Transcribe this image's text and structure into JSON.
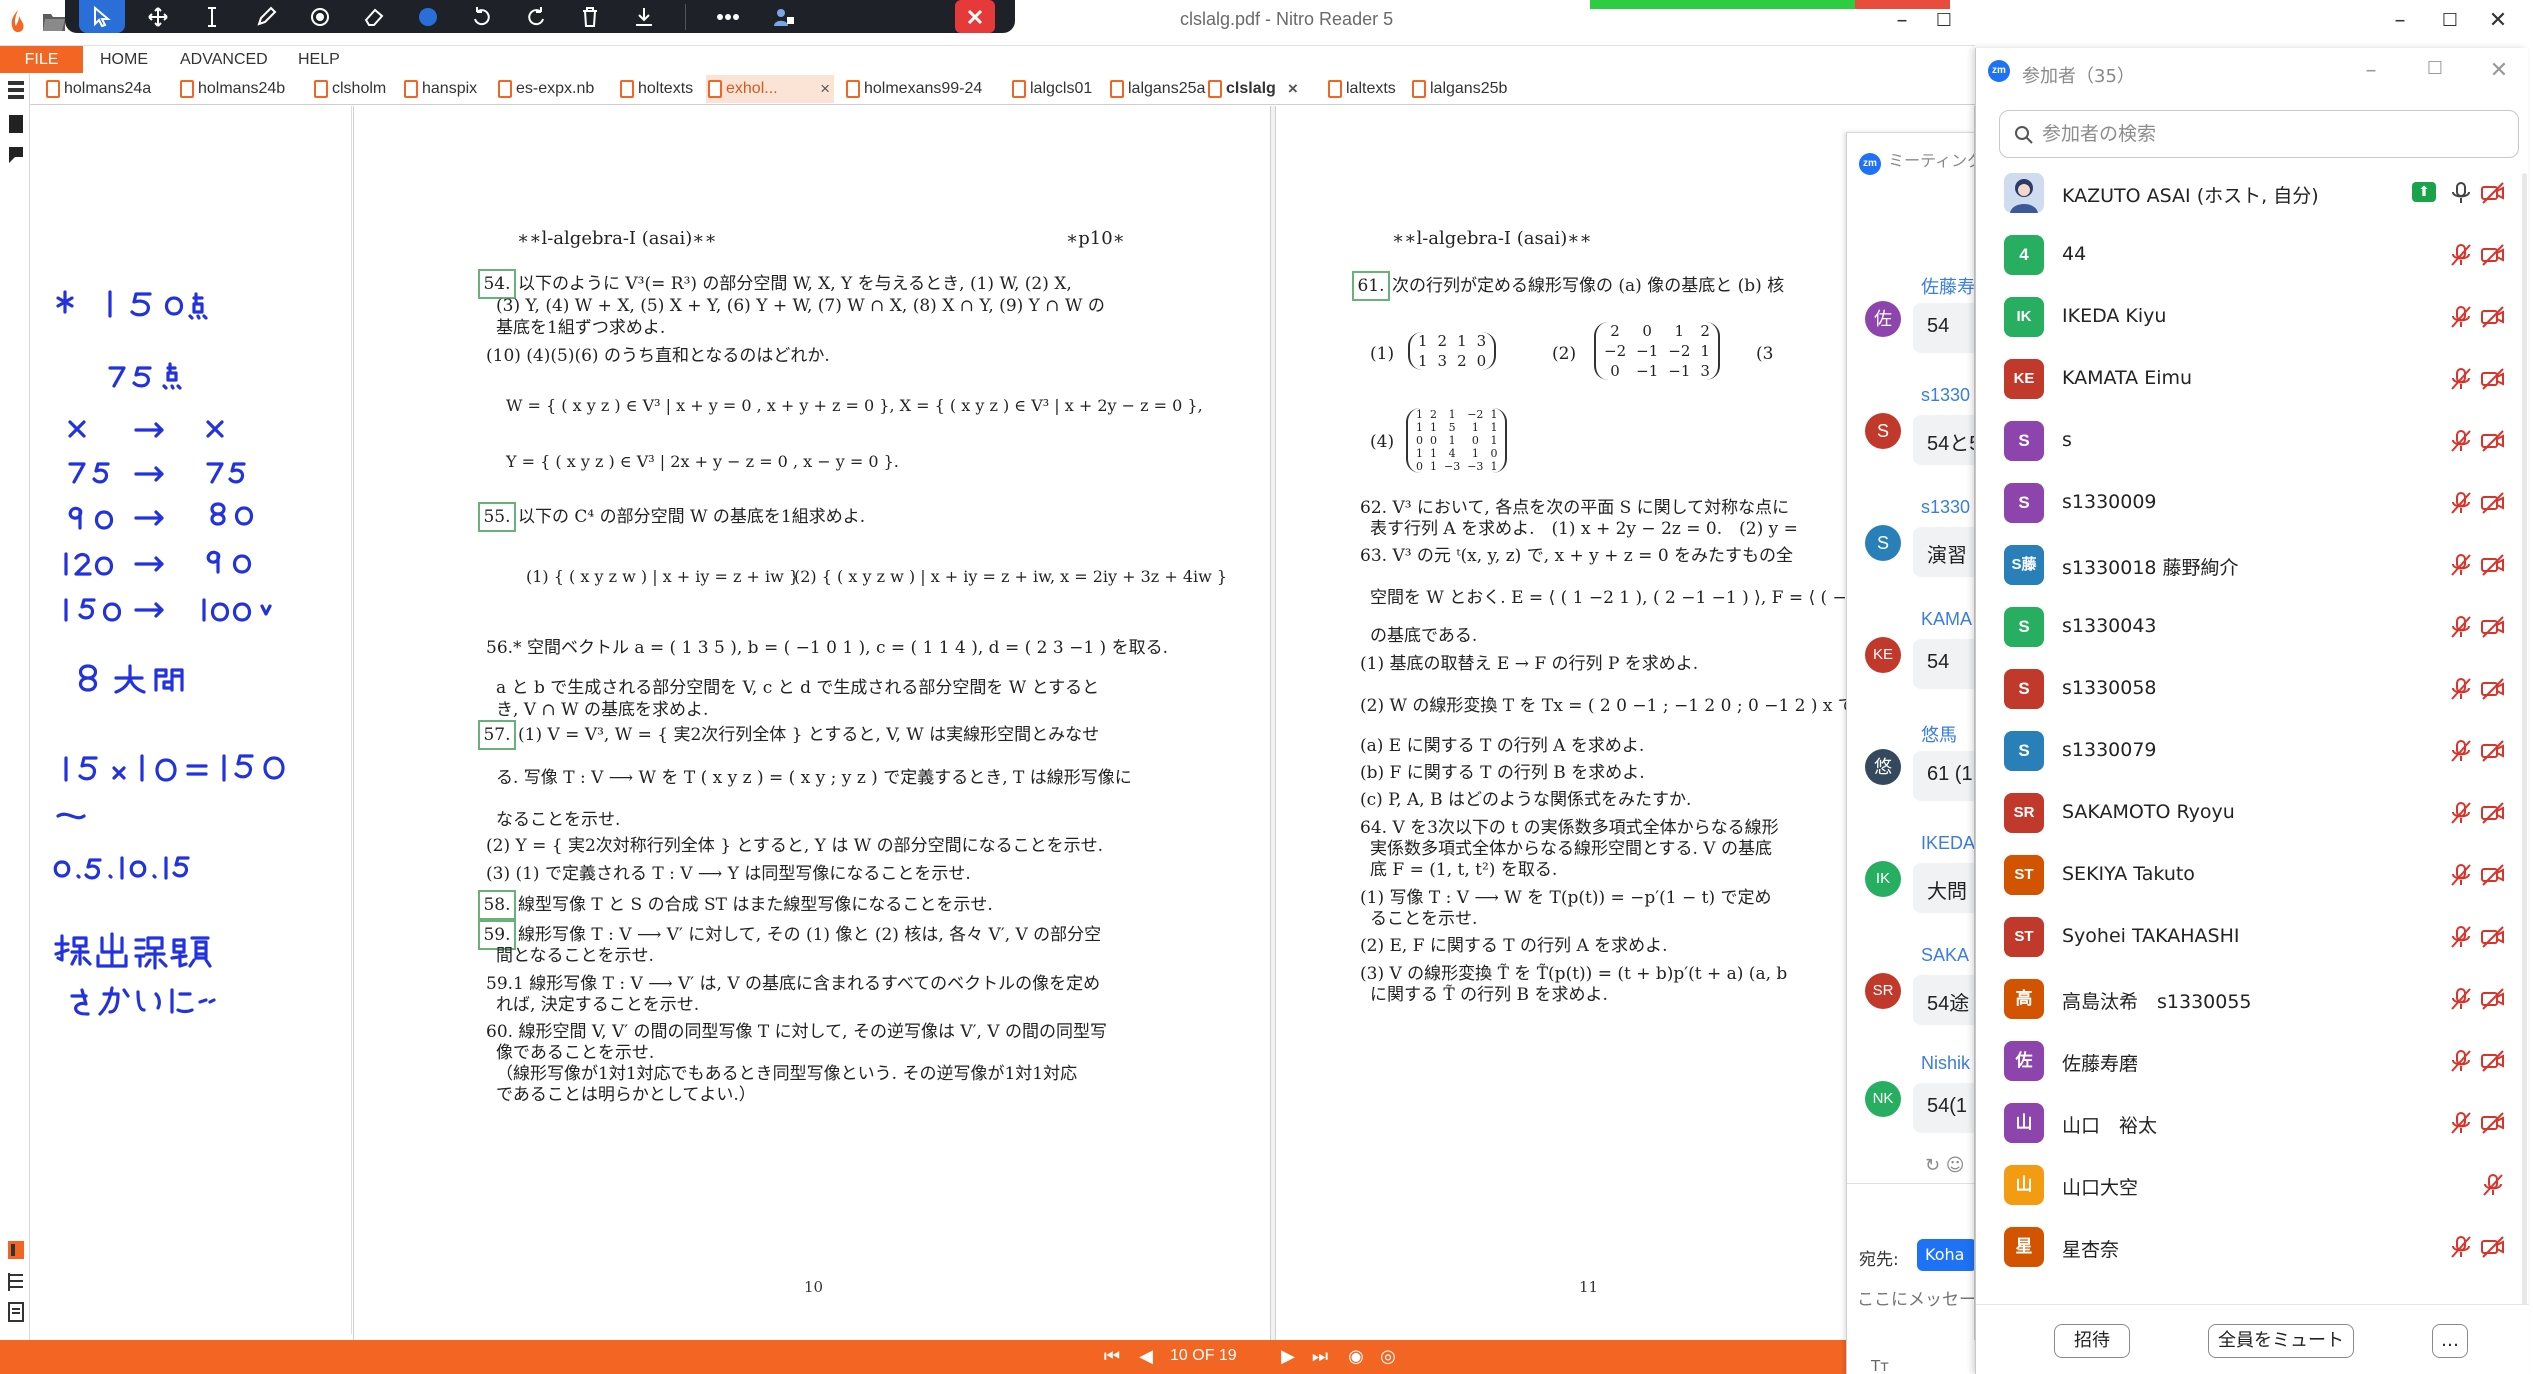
{
  "window": {
    "title": "clslalg.pdf - Nitro Reader 5",
    "controls": [
      "minimize-icon",
      "maximize-icon",
      "close-icon"
    ]
  },
  "annotation_toolbar": {
    "tools": [
      "select-arrow-icon",
      "move-icon",
      "text-cursor-icon",
      "pen-icon",
      "highlighter-icon",
      "eraser-icon",
      "color-dot-icon",
      "undo-icon",
      "redo-icon",
      "trash-icon",
      "download-icon",
      "more-icon",
      "share-screen-icon",
      "close-icon"
    ],
    "accent": "#2a6fd8"
  },
  "menu": {
    "file": "FILE",
    "items": [
      "HOME",
      "ADVANCED",
      "HELP"
    ],
    "accent": "#f26522"
  },
  "tabs": [
    {
      "label": "holmans24a"
    },
    {
      "label": "holmans24b"
    },
    {
      "label": "clsholm"
    },
    {
      "label": "hanspix"
    },
    {
      "label": "es-expx.nb"
    },
    {
      "label": "holtexts"
    },
    {
      "label": "exhol...",
      "close": "×"
    },
    {
      "label": "holmexans99-24"
    },
    {
      "label": "lalgcls01"
    },
    {
      "label": "lalgans25a"
    },
    {
      "label": "clslalg",
      "close": "×"
    },
    {
      "label": "laltexts"
    },
    {
      "label": "lalgans25b"
    }
  ],
  "handwritten_notes": [
    "※ 150点",
    "75点",
    "x → x",
    "75 → 75",
    "90 → 80",
    "120 → 90",
    "150 → 100",
    "8大問",
    "15×10=150",
    "0.5.10.15",
    "提出課題",
    "さかいに"
  ],
  "page_left": {
    "header": "∗∗l-algebra-I (asai)∗∗",
    "page_tag": "∗p10∗",
    "problems": {
      "p54_num": "54.",
      "p54_line1": "以下のように V³(= R³) の部分空間 W, X, Y を与えるとき, (1) W, (2) X,",
      "p54_line2": "(3) Y, (4) W + X, (5) X + Y, (6) Y + W, (7) W ∩ X, (8) X ∩ Y, (9) Y ∩ W の",
      "p54_line3": "基底を1組ずつ求めよ.",
      "p54_line4": "(10) (4)(5)(6) のうち直和となるのはどれか.",
      "p54_W": "W = { ( x y z ) ∈ V³ | x + y = 0 , x + y + z = 0 }, X = { ( x y z ) ∈ V³ | x + 2y − z = 0 },",
      "p54_Y": "Y = { ( x y z ) ∈ V³ | 2x + y − z = 0 , x − y = 0 }.",
      "p55_num": "55.",
      "p55_line1": "以下の C⁴ の部分空間 W の基底を1組求めよ.",
      "p55_set1": "(1) { ( x y z w ) | x + iy = z + iw }",
      "p55_set2": "(2) { ( x y z w ) | x + iy = z + iw, x = 2iy + 3z + 4iw }",
      "p56_line1": "56.* 空間ベクトル a = ( 1 3 5 ), b = ( −1 0 1 ), c = ( 1 1 4 ), d = ( 2 3 −1 ) を取る.",
      "p56_line2": "a と b で生成される部分空間を V, c と d で生成される部分空間を W とすると",
      "p56_line3": "き, V ∩ W の基底を求めよ.",
      "p57_num": "57.",
      "p57_line1": "(1) V = V³, W = { 実2次行列全体 } とすると, V, W は実線形空間とみなせ",
      "p57_line2": "る. 写像 T : V ⟶ W を T ( x y z ) = ( x y ; y z ) で定義するとき, T は線形写像に",
      "p57_line3": "なることを示せ.",
      "p57_line4": "(2) Y = { 実2次対称行列全体 } とすると, Y は W の部分空間になることを示せ.",
      "p57_line5": "(3) (1) で定義される T : V ⟶ Y は同型写像になることを示せ.",
      "p58_num": "58.",
      "p58_line1": "線型写像 T と S の合成 ST はまた線型写像になることを示せ.",
      "p59_num": "59.",
      "p59_line1": "線形写像 T : V ⟶ V′ に対して, その (1) 像と (2) 核は, 各々 V′, V の部分空",
      "p59_line2": "間となることを示せ.",
      "p591_line1": "59.1 線形写像 T : V ⟶ V′ は, V の基底に含まれるすべてのベクトルの像を定め",
      "p591_line2": "れば, 決定することを示せ.",
      "p60_line1": "60. 線形空間 V, V′ の間の同型写像 T に対して, その逆写像は V′, V の間の同型写",
      "p60_line2": "像であることを示せ.",
      "p60_line3": "（線形写像が1対1対応でもあるとき同型写像という. その逆写像が1対1対応",
      "p60_line4": "であることは明らかとしてよい.）"
    },
    "footer": "10"
  },
  "page_right": {
    "header": "∗∗l-algebra-I (asai)∗∗",
    "problems": {
      "p61_num": "61.",
      "p61_line1": "次の行列が定める線形写像の (a) 像の基底と (b) 核",
      "m1_label": "(1)",
      "m1": [
        "1",
        "2",
        "1",
        "3",
        "1",
        "3",
        "2",
        "0"
      ],
      "m2_label": "(2)",
      "m2": [
        "2",
        "0",
        "1",
        "2",
        "−2",
        "−1",
        "−2",
        "1",
        "0",
        "−1",
        "−1",
        "3"
      ],
      "m3_label": "(3",
      "m4_label": "(4)",
      "m4": [
        "1",
        "2",
        "1",
        "−2",
        "1",
        "1",
        "1",
        "5",
        "1",
        "1",
        "0",
        "0",
        "1",
        "0",
        "1",
        "1",
        "1",
        "4",
        "1",
        "0",
        "0",
        "1",
        "−3",
        "−3",
        "1"
      ],
      "p62_line1": "62. V³ において, 各点を次の平面 S に関して対称な点に",
      "p62_line2": "表す行列 A を求めよ.　(1) x + 2y − 2z = 0.　(2) y =",
      "p63_line1": "63. V³ の元 ᵗ(x, y, z) で, x + y + z = 0 をみたすもの全",
      "p63_line2": "空間を W とおく. E = ⟨ ( 1 −2 1 ), ( 2 −1 −1 ) ⟩, F = ⟨ ( −1",
      "p63_line3": "の基底である.",
      "p63_line4": "(1) 基底の取替え E → F の行列 P を求めよ.",
      "p63_line5": "(2) W の線形変換 T を Tx = ( 2 0 −1 ; −1 2 0 ; 0 −1 2 ) x で定義",
      "p63_line6": "(a) E に関する T の行列 A を求めよ.",
      "p63_line7": "(b) F に関する T の行列 B を求めよ.",
      "p63_line8": "(c) P, A, B はどのような関係式をみたすか.",
      "p64_line1": "64. V を3次以下の t の実係数多項式全体からなる線形",
      "p64_line2": "実係数多項式全体からなる線形空間とする. V の基底",
      "p64_line3": "底 F = (1, t, t²) を取る.",
      "p64_line4": "(1) 写像 T : V ⟶ W を T(p(t)) = −p′(1 − t) で定め",
      "p64_line5": "ることを示せ.",
      "p64_line6": "(2) E, F に関する T の行列 A を求めよ.",
      "p64_line7": "(3) V の線形変換 T̃ を T̃(p(t)) = (t + b)p′(t + a)  (a, b",
      "p64_line8": "に関する T̃ の行列 B を求めよ."
    },
    "footer": "11"
  },
  "navigation": {
    "page_indicator": "10 OF 19"
  },
  "zoom_chat": {
    "title": "ミーティング",
    "badge": "zm",
    "messages": [
      {
        "avatar": "佐",
        "name": "佐藤寿",
        "text": "54",
        "color": "#8e44ad"
      },
      {
        "avatar": "S",
        "name": "s1330",
        "text": "54と5",
        "color": "#c0392b"
      },
      {
        "avatar": "S",
        "name": "s1330",
        "text": "演習",
        "color": "#2980b9"
      },
      {
        "avatar": "KE",
        "name": "KAMA",
        "text": "54",
        "color": "#c0392b"
      },
      {
        "avatar": "悠",
        "name": "悠馬",
        "text": "61 (1",
        "color": "#34495e"
      },
      {
        "avatar": "IK",
        "name": "IKEDA",
        "text": "大問",
        "color": "#27ae60"
      },
      {
        "avatar": "SR",
        "name": "SAKA",
        "text": "54途",
        "color": "#c0392b"
      },
      {
        "avatar": "NK",
        "name": "Nishik",
        "text": "54(1",
        "color": "#27ae60"
      }
    ],
    "to_label": "宛先:",
    "to_value": "Koha",
    "input_placeholder": "ここにメッセー"
  },
  "participants": {
    "title": "参加者（35）",
    "search_placeholder": "参加者の検索",
    "list": [
      {
        "avatar": "",
        "name": "KAZUTO ASAI (ホスト, 自分)",
        "color": "#5b8dd6",
        "host": true
      },
      {
        "avatar": "4",
        "name": "44",
        "color": "#27ae60"
      },
      {
        "avatar": "IK",
        "name": "IKEDA Kiyu",
        "color": "#27ae60"
      },
      {
        "avatar": "KE",
        "name": "KAMATA Eimu",
        "color": "#c0392b"
      },
      {
        "avatar": "S",
        "name": "s",
        "color": "#8e44ad"
      },
      {
        "avatar": "S",
        "name": "s1330009",
        "color": "#8e44ad"
      },
      {
        "avatar": "S藤",
        "name": "s1330018 藤野絢介",
        "color": "#2980b9"
      },
      {
        "avatar": "S",
        "name": "s1330043",
        "color": "#27ae60"
      },
      {
        "avatar": "S",
        "name": "s1330058",
        "color": "#c0392b"
      },
      {
        "avatar": "S",
        "name": "s1330079",
        "color": "#2980b9"
      },
      {
        "avatar": "SR",
        "name": "SAKAMOTO Ryoyu",
        "color": "#c0392b"
      },
      {
        "avatar": "ST",
        "name": "SEKIYA Takuto",
        "color": "#d35400"
      },
      {
        "avatar": "ST",
        "name": "Syohei TAKAHASHI",
        "color": "#c0392b"
      },
      {
        "avatar": "高",
        "name": "高島汰希　s1330055",
        "color": "#d35400"
      },
      {
        "avatar": "佐",
        "name": "佐藤寿磨",
        "color": "#8e44ad"
      },
      {
        "avatar": "山",
        "name": "山口　裕太",
        "color": "#8e44ad"
      },
      {
        "avatar": "山",
        "name": "山口大空",
        "color": "#f39c12"
      },
      {
        "avatar": "星",
        "name": "星杏奈",
        "color": "#d35400"
      }
    ],
    "buttons": {
      "invite": "招待",
      "mute_all": "全員をミュート",
      "more": "…"
    }
  }
}
